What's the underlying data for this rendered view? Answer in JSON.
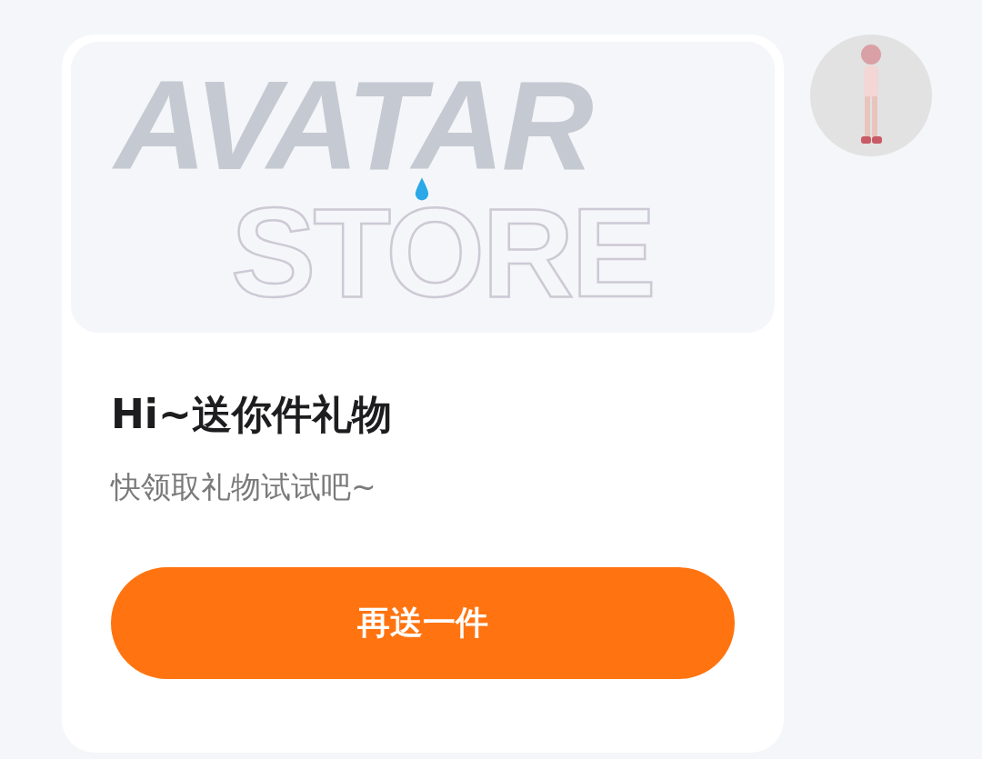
{
  "banner": {
    "line_1": "AVATAR",
    "line_2": "STORE"
  },
  "title": "Hi~送你件礼物",
  "subtitle": "快领取礼物试试吧~",
  "button": {
    "label": "再送一件"
  }
}
